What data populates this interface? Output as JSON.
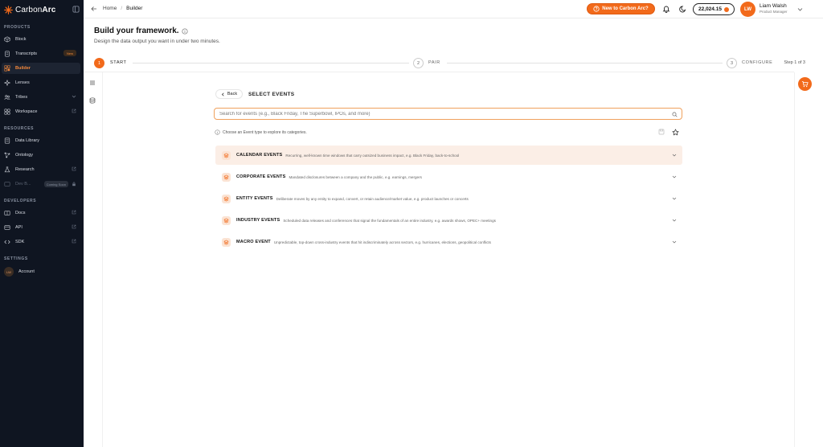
{
  "brand": {
    "name_light": "Carbon",
    "name_bold": "Arc"
  },
  "sidebar": {
    "products_label": "PRODUCTS",
    "resources_label": "RESOURCES",
    "developers_label": "DEVELOPERS",
    "settings_label": "SETTINGS",
    "products": [
      {
        "label": "Block"
      },
      {
        "label": "Transcripts",
        "badge": "New"
      },
      {
        "label": "Builder"
      },
      {
        "label": "Lenses"
      },
      {
        "label": "Tribes"
      },
      {
        "label": "Workspace"
      }
    ],
    "resources": [
      {
        "label": "Data Library"
      },
      {
        "label": "Ontology"
      },
      {
        "label": "Research"
      },
      {
        "label": "Dev B...",
        "badge": "Coming Soon"
      }
    ],
    "developers": [
      {
        "label": "Docs"
      },
      {
        "label": "API"
      },
      {
        "label": "SDK"
      }
    ],
    "account": {
      "initials": "LW",
      "label": "Account"
    }
  },
  "topbar": {
    "breadcrumb_home": "Home",
    "breadcrumb_sep": "/",
    "breadcrumb_current": "Builder",
    "promo_label": "New to Carbon Arc?",
    "credits": "22,024.15",
    "user_initials": "LW",
    "user_name": "Liam Walsh",
    "user_role": "Product Manager"
  },
  "header": {
    "title": "Build your framework.",
    "subtitle": "Design the data output you want in under two minutes."
  },
  "stepper": {
    "steps": [
      {
        "num": "1",
        "label": "START"
      },
      {
        "num": "2",
        "label": "PAIR"
      },
      {
        "num": "3",
        "label": "CONFIGURE"
      }
    ],
    "count": "Step 1 of 3"
  },
  "main": {
    "back_label": "Back",
    "section_title": "SELECT EVENTS",
    "search_placeholder": "Search for events (e.g., Black Friday, The Superbowl, IPOs, and more)",
    "hint": "Choose an Event type to explore its categories.",
    "events": [
      {
        "name": "CALENDAR EVENTS",
        "desc": "Recurring, well-known time windows that carry outsized business impact, e.g. Black Friday, back-to-school"
      },
      {
        "name": "CORPORATE EVENTS",
        "desc": "Mandated disclosures between a company and the public, e.g. earnings, mergers"
      },
      {
        "name": "ENTITY EVENTS",
        "desc": "Deliberate moves by any entity to expand, convert, or retain audience/market value, e.g. product launches or concerts"
      },
      {
        "name": "INDUSTRY EVENTS",
        "desc": "Scheduled data releases and conferences that signal the fundamentals of an entire industry, e.g. awards shows, OPEC+ meetings"
      },
      {
        "name": "MACRO EVENT",
        "desc": "Unpredictable, top-down cross-industry events that hit indiscriminately across sectors, e.g. hurricanes, elections, geopolitical conflicts"
      }
    ]
  },
  "colors": {
    "accent": "#f26a1b",
    "sidebar_bg": "#0f1521",
    "highlight_row": "#fbeee6"
  },
  "icons": [
    "carbonarc-logo-icon",
    "sidebar-collapse-icon",
    "cube-icon",
    "transcript-icon",
    "builder-icon",
    "lenses-icon",
    "tribes-icon",
    "workspace-icon",
    "library-icon",
    "ontology-icon",
    "research-icon",
    "dev-icon",
    "docs-icon",
    "api-icon",
    "code-icon",
    "external-link-icon",
    "chevron-down-icon",
    "arrow-left-icon",
    "bell-icon",
    "moon-icon",
    "coin-icon",
    "info-icon",
    "list-icon",
    "database-icon",
    "cart-icon",
    "search-icon",
    "save-icon",
    "star-icon",
    "layers-icon"
  ]
}
